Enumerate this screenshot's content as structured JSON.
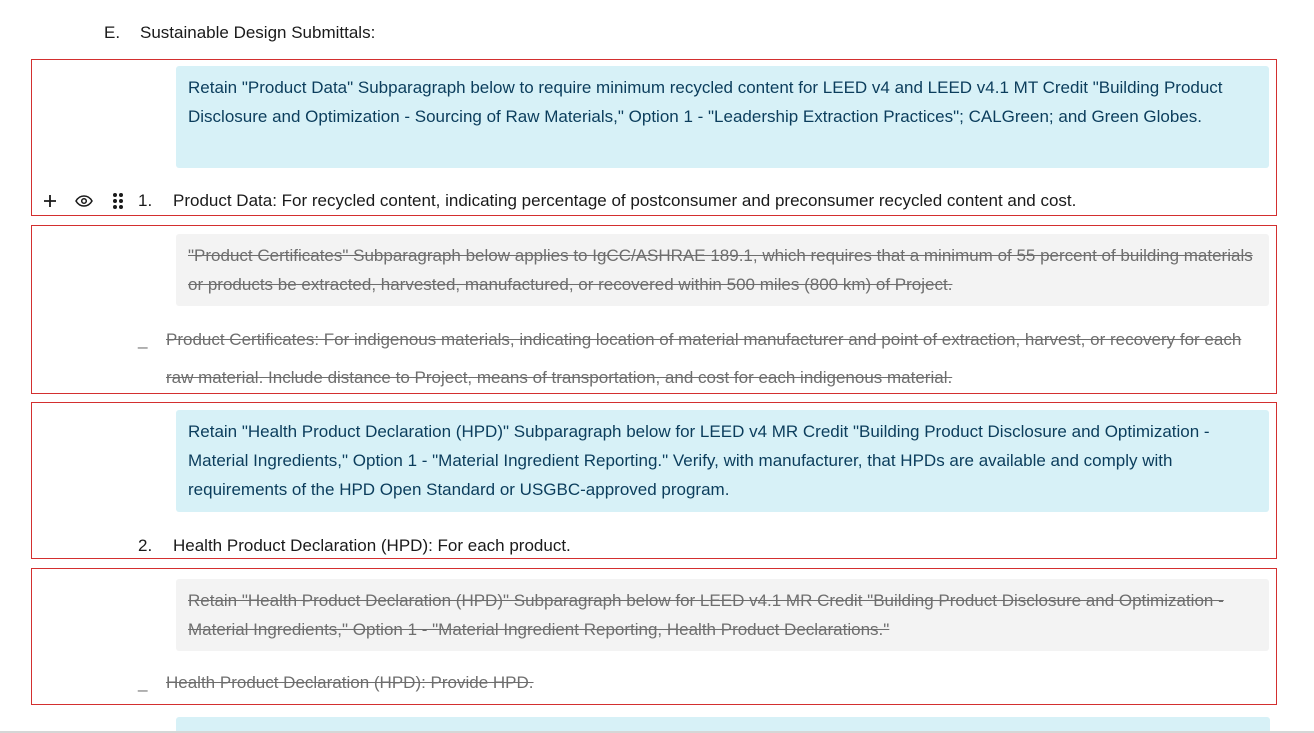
{
  "heading": {
    "number": "E.",
    "text": "Sustainable Design Submittals:"
  },
  "blocks": [
    {
      "note": "Retain \"Product Data\" Subparagraph below to require minimum recycled content for LEED v4 and LEED v4.1 MT Credit \"Building Product Disclosure and Optimization - Sourcing of Raw Materials,\" Option 1 - \"Leadership Extraction Practices\"; CALGreen; and Green Globes.",
      "number": "1.",
      "text": "Product Data: For recycled content, indicating percentage of postconsumer and preconsumer recycled content and cost."
    },
    {
      "note": "\"Product Certificates\" Subparagraph below applies to IgCC/ASHRAE 189.1, which requires that a minimum of 55 percent of building materials or products be extracted, harvested, manufactured, or recovered within 500 miles (800 km) of Project.",
      "number": "_",
      "text": "Product Certificates: For indigenous materials, indicating location of material manufacturer and point of extraction, harvest, or recovery for each raw material. Include distance to Project, means of transportation, and cost for each indigenous material."
    },
    {
      "note": "Retain \"Health Product Declaration (HPD)\" Subparagraph below for LEED v4 MR Credit \"Building Product Disclosure and Optimization - Material Ingredients,\" Option 1 - \"Material Ingredient Reporting.\" Verify, with manufacturer, that HPDs are available and comply with requirements of the HPD Open Standard or USGBC-approved program.",
      "number": "2.",
      "text": "Health Product Declaration (HPD): For each product."
    },
    {
      "note": "Retain \"Health Product Declaration (HPD)\" Subparagraph below for LEED v4.1 MR Credit \"Building Product Disclosure and Optimization - Material Ingredients,\" Option 1 - \"Material Ingredient Reporting, Health Product Declarations.\"",
      "number": "_",
      "text": "Health Product Declaration (HPD): Provide HPD."
    }
  ],
  "icons": [
    "plus-icon",
    "eye-icon",
    "drag-handle-icon"
  ]
}
